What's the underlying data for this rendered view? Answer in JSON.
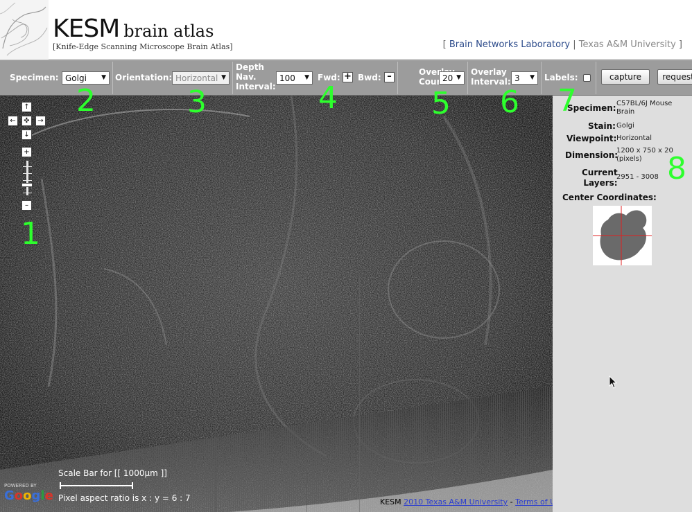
{
  "header": {
    "logo_main": "KESM",
    "logo_sub": "brain atlas",
    "tagline": "[Knife-Edge Scanning Microscope Brain Atlas]",
    "bracket_open": "[",
    "lab_name": "Brain Networks Laboratory",
    "divider": "|",
    "university": "Texas A&M University",
    "bracket_close": "]"
  },
  "toolbar": {
    "specimen_label": "Specimen:",
    "specimen_value": "Golgi",
    "orientation_label": "Orientation:",
    "orientation_value": "Horizontal",
    "depth_label_1": "Depth",
    "depth_label_2": "Nav.",
    "depth_label_3": "Interval:",
    "depth_value": "100",
    "fwd_label": "Fwd:",
    "fwd_symbol": "+",
    "bwd_label": "Bwd:",
    "bwd_symbol": "–",
    "overlay_count_label_1": "Overlay",
    "overlay_count_label_2": "Count:",
    "overlay_count_value": "20",
    "overlay_interval_label_1": "Overlay",
    "overlay_interval_label_2": "Interval:",
    "overlay_interval_value": "3",
    "labels_label": "Labels:",
    "labels_checked": false,
    "capture_label": "capture",
    "request_label": "request"
  },
  "map": {
    "nav": {
      "up": "↑",
      "left": "←",
      "center": "✜",
      "right": "→",
      "down": "↓",
      "zoom_in": "+",
      "zoom_out": "–"
    },
    "zoom_level_fraction": 0.68,
    "scale_title": "Scale Bar for [[ 1000μm ]]",
    "aspect_ratio": "Pixel aspect ratio is x : y = 6 : 7",
    "powered_by": "POWERED BY",
    "google_letters": [
      "G",
      "o",
      "o",
      "g",
      "l",
      "e"
    ],
    "google_colors": [
      "#3a6fd8",
      "#d8352a",
      "#f1b400",
      "#3a6fd8",
      "#2a9d3f",
      "#d8352a"
    ],
    "copyright_prefix": "KESM",
    "copyright_link": "2010 Texas A&M University",
    "copyright_sep": "-",
    "terms_link": "Terms of Use"
  },
  "info": {
    "specimen_label": "Specimen:",
    "specimen_value_1": "C57BL/6J Mouse",
    "specimen_value_2": "Brain",
    "stain_label": "Stain:",
    "stain_value": "Golgi",
    "viewpoint_label": "Viewpoint:",
    "viewpoint_value": "Horizontal",
    "dimension_label": "Dimension:",
    "dimension_value_1": "1200 x 750 x 20",
    "dimension_value_2": "(pixels)",
    "layers_label_1": "Current",
    "layers_label_2": "Layers:",
    "layers_value": "2951 - 3008",
    "center_label": "Center Coordinates:"
  },
  "annotations": [
    "1",
    "2",
    "3",
    "4",
    "5",
    "6",
    "7",
    "8"
  ],
  "colors": {
    "toolbar_bg": "#9c9c9c",
    "panel_bg": "#dedede",
    "annotation": "#2dff2d",
    "lab_link": "#2b4a8a"
  }
}
